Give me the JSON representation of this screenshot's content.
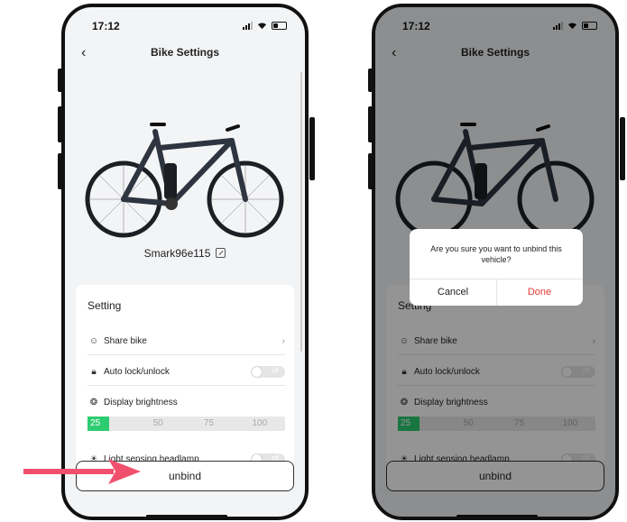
{
  "status": {
    "time": "17:12"
  },
  "nav": {
    "title": "Bike Settings"
  },
  "bike": {
    "name": "Smark96e115"
  },
  "setting": {
    "title": "Setting",
    "share_label": "Share bike",
    "autolock_label": "Auto lock/unlock",
    "autolock_state": "off",
    "brightness_label": "Display brightness",
    "brightness_levels": [
      "25",
      "50",
      "75",
      "100"
    ],
    "brightness_selected": "25",
    "headlamp_label": "Light sensing headlamp",
    "headlamp_state": "off"
  },
  "unbind_label": "unbind",
  "dialog": {
    "message": "Are you sure you want to unbind this vehicle?",
    "cancel_label": "Cancel",
    "done_label": "Done"
  },
  "colors": {
    "accent_green": "#2ecc71",
    "done_red": "#e53935",
    "arrow": "#f0506e"
  },
  "icons": [
    "back-chevron-icon",
    "edit-icon",
    "share-icon",
    "lock-icon",
    "bulb-icon",
    "sun-icon",
    "chevron-right-icon"
  ]
}
